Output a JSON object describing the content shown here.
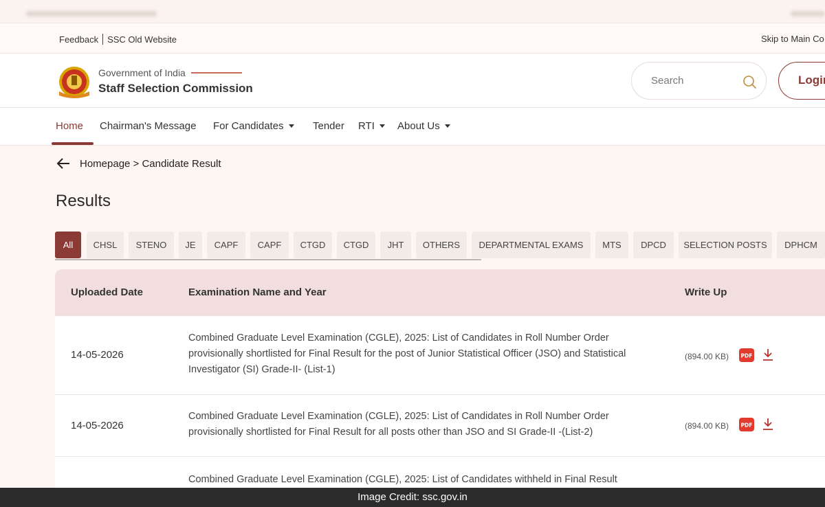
{
  "topbar": {
    "feedback": "Feedback",
    "old_website": "SSC Old Website",
    "skip": "Skip to Main Co"
  },
  "header": {
    "gov": "Government of India",
    "org": "Staff Selection Commission",
    "search_placeholder": "Search",
    "login": "Login"
  },
  "nav": {
    "items": [
      "Home",
      "Chairman's Message",
      "For Candidates",
      "Tender",
      "RTI",
      "About Us"
    ]
  },
  "breadcrumb": "Homepage > Candidate Result",
  "page_title": "Results",
  "tabs": [
    "All",
    "CHSL",
    "STENO",
    "JE",
    "CAPF",
    "CAPF",
    "CTGD",
    "CTGD",
    "JHT",
    "OTHERS",
    "DEPARTMENTAL EXAMS",
    "MTS",
    "DPCD",
    "SELECTION POSTS",
    "DPHCM"
  ],
  "table": {
    "headers": [
      "Uploaded Date",
      "Examination Name and Year",
      "Write Up"
    ],
    "rows": [
      {
        "date": "14-05-2026",
        "name": "Combined Graduate Level Examination (CGLE), 2025: List of Candidates in Roll Number Order provisionally shortlisted for Final Result for the post of Junior Statistical Officer (JSO) and Statistical Investigator (SI) Grade-II- (List-1)",
        "size": "(894.00 KB)"
      },
      {
        "date": "14-05-2026",
        "name": "Combined Graduate Level Examination (CGLE), 2025: List of Candidates in Roll Number Order provisionally shortlisted for Final Result for all posts other than JSO and SI Grade-II -(List-2)",
        "size": "(894.00 KB)"
      },
      {
        "date": "",
        "name": "Combined Graduate Level Examination (CGLE), 2025: List of Candidates withheld in Final Result",
        "size": ""
      }
    ],
    "pdf_label": "PDF"
  },
  "credit": "Image Credit: ssc.gov.in",
  "colors": {
    "accent": "#8b3a36",
    "header_row": "#f2dede",
    "page_bg": "#fdf6f3"
  }
}
